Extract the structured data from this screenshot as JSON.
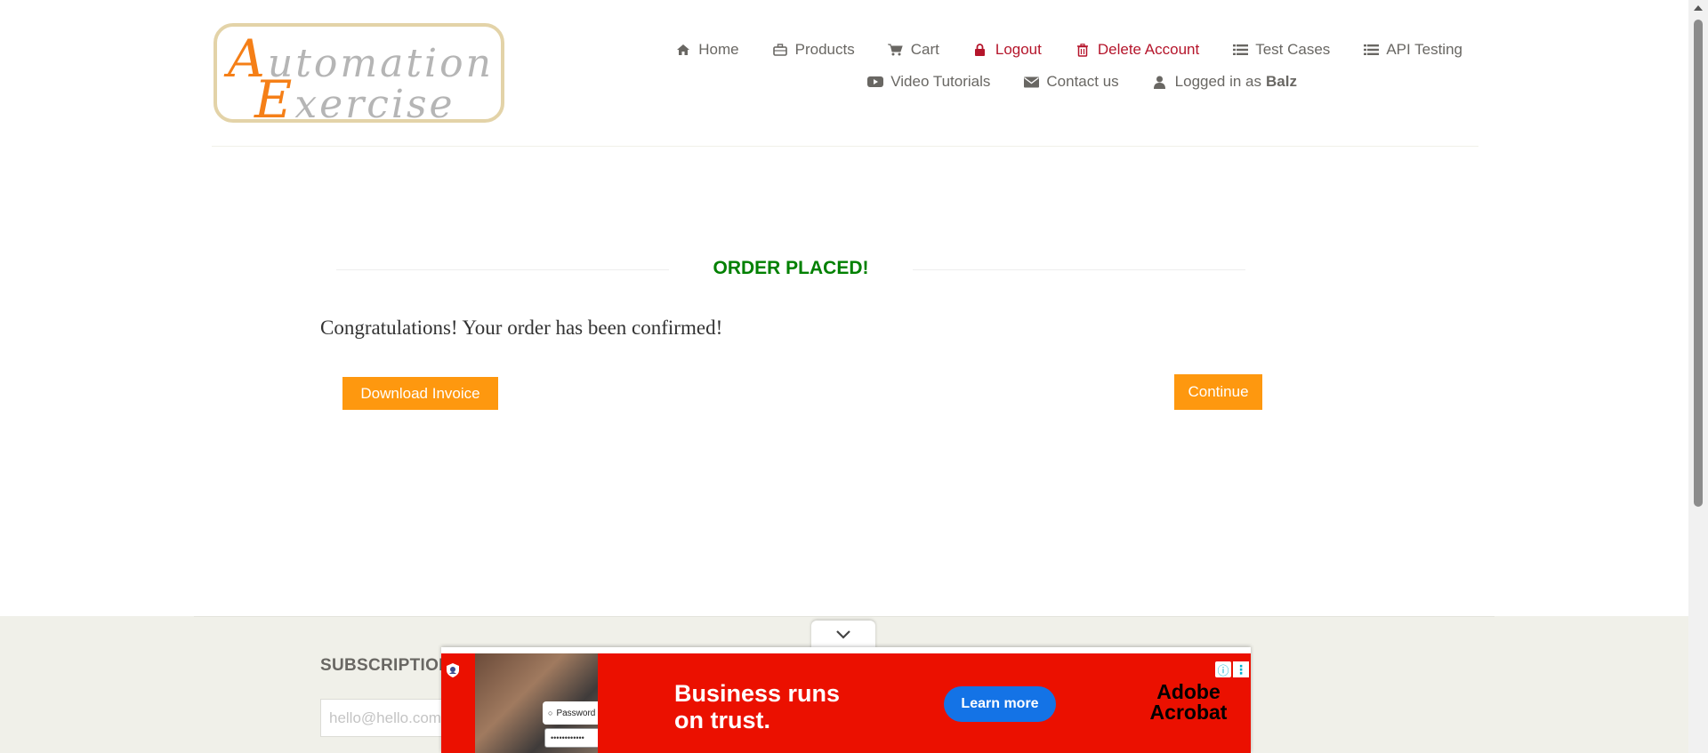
{
  "logo": {
    "line1_cap": "A",
    "line1_rest": "utomation",
    "line2_cap": "E",
    "line2_rest": "xercise"
  },
  "nav": {
    "home": "Home",
    "products": "Products",
    "cart": "Cart",
    "logout": "Logout",
    "delete_account": "Delete Account",
    "test_cases": "Test Cases",
    "api_testing": "API Testing",
    "video_tutorials": "Video Tutorials",
    "contact_us": "Contact us",
    "logged_in_as": "Logged in as",
    "username": "Balz"
  },
  "main": {
    "title": "ORDER PLACED!",
    "message": "Congratulations! Your order has been confirmed!",
    "download_invoice": "Download Invoice",
    "continue": "Continue"
  },
  "footer": {
    "subscription_title": "SUBSCRIPTION",
    "email_placeholder": "hello@hello.com"
  },
  "ad": {
    "password_protect": "Password protect",
    "password_dots": "••••••••••••",
    "headline_line1": "Business runs",
    "headline_line2": "on trust.",
    "cta": "Learn more",
    "brand_line1": "Adobe",
    "brand_line2": "Acrobat",
    "banner_color": "#eb1000",
    "cta_color": "#1473e6"
  },
  "colors": {
    "accent": "#fe980f",
    "success": "#008000",
    "danger": "#b5152b"
  }
}
